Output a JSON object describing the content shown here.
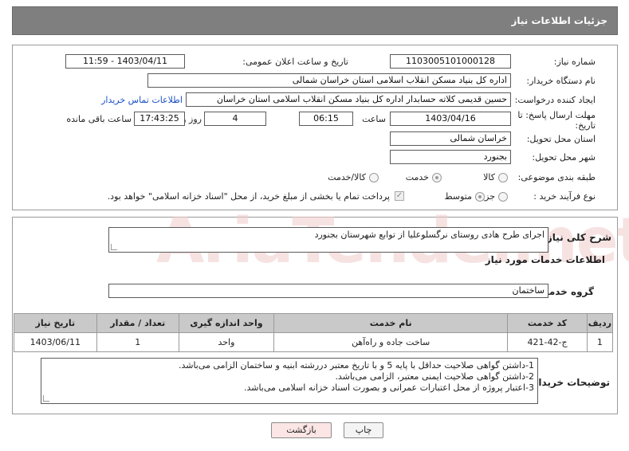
{
  "header": {
    "title": "جزئیات اطلاعات نیاز"
  },
  "fields": {
    "need_number_label": "شماره نیاز:",
    "need_number": "1103005101000128",
    "announce_label": "تاریخ و ساعت اعلان عمومی:",
    "announce_value": "1403/04/11 - 11:59",
    "buyer_label": "نام دستگاه خریدار:",
    "buyer_value": "اداره کل بنیاد مسکن انقلاب اسلامی استان خراسان شمالی",
    "creator_label": "ایجاد کننده درخواست:",
    "creator_value": "حسین قدیمی کلاته حسابدار اداره کل بنیاد مسکن انقلاب اسلامی استان خراسان",
    "contact_link": "اطلاعات تماس خریدار",
    "deadline_label_1": "مهلت ارسال پاسخ: تا",
    "deadline_label_2": "تاریخ:",
    "deadline_date": "1403/04/16",
    "time_label": "ساعت",
    "deadline_time": "06:15",
    "days_value": "4",
    "days_label": "روز و",
    "remaining_time": "17:43:25",
    "remaining_label": "ساعت باقی مانده",
    "province_label": "استان محل تحویل:",
    "province_value": "خراسان شمالی",
    "city_label": "شهر محل تحویل:",
    "city_value": "بجنورد",
    "category_label": "طبقه بندی موضوعی:",
    "category_options": [
      "کالا",
      "خدمت",
      "کالا/خدمت"
    ],
    "process_label": "نوع فرآیند خرید :",
    "process_options": [
      "جزیی",
      "متوسط"
    ],
    "payment_note": "پرداخت تمام یا بخشی از مبلغ خرید، از محل \"اسناد خزانه اسلامی\" خواهد بود."
  },
  "summary": {
    "label": "شرح کلی نیاز:",
    "value": "اجرای طرح هادی روستای نرگسلوعلیا از توابع شهرستان بجنورد"
  },
  "services": {
    "title": "اطلاعات خدمات مورد نیاز",
    "group_label": "گروه خدمت:",
    "group_value": "ساختمان",
    "columns": [
      "ردیف",
      "کد خدمت",
      "نام خدمت",
      "واحد اندازه گیری",
      "تعداد / مقدار",
      "تاریخ نیاز"
    ],
    "rows": [
      [
        "1",
        "ج-42-421",
        "ساخت جاده و راه‌آهن",
        "واحد",
        "1",
        "1403/06/11"
      ]
    ]
  },
  "buyer_notes": {
    "label": "توضیحات خریدار:",
    "lines": [
      "1-داشتن گواهی صلاحیت حداقل با پایه 5 و با تاریخ معتبر دررشته ابنیه و ساختمان الزامی می‌باشد.",
      "2-داشتن گواهی صلاحیت ایمنی معتبر، الزامی می‌باشد.",
      "3-اعتبار پروژه از محل اعتبارات عمرانی و بصورت اسناد خزانه اسلامی می‌باشد."
    ]
  },
  "buttons": {
    "print": "چاپ",
    "back": "بازگشت"
  },
  "watermark": "AriaTender.net"
}
